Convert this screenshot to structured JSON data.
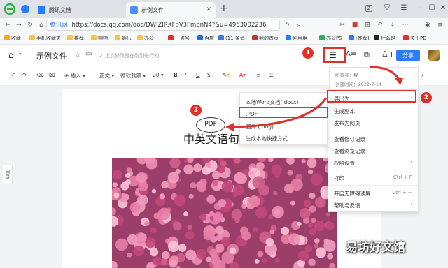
{
  "browser": {
    "tabs": [
      {
        "label": "腾讯文档"
      },
      {
        "label": "示例文件"
      }
    ],
    "new_tab": "+",
    "window_badge": "2",
    "url": "https://docs.qq.com/doc/DWlZlRXFpV3FmbnN4?&u=4963002236",
    "url_shown": "https://docs.qq.com/doc/DWIZIRXFpV3FmbnN4?&u=4963002236",
    "site_label": "腾讯网"
  },
  "bookmarks": [
    {
      "label": "收藏"
    },
    {
      "label": "手机收藏夹"
    },
    {
      "label": "推荐"
    },
    {
      "label": "购物"
    },
    {
      "label": "娱乐"
    },
    {
      "label": "办公"
    },
    {
      "label": "一点号"
    },
    {
      "label": "百度"
    },
    {
      "label": "(11 条消"
    },
    {
      "label": "我的首页"
    },
    {
      "label": "剧用用"
    },
    {
      "label": "办公PS"
    },
    {
      "label": "[推荐]"
    },
    {
      "label": "什么是"
    },
    {
      "label": "关于PD"
    }
  ],
  "doc": {
    "title": "示例文件",
    "save_status": "上次修改是在刚刚进行的",
    "share_label": "分享",
    "toolbar": {
      "insert": "插入",
      "style": "正文",
      "font": "微软雅黑",
      "size": "20"
    },
    "heading": "中英文语句",
    "side_tab": "目录"
  },
  "owner_info": {
    "owner": "所有者：我",
    "created": "创建时间：2022-7-14"
  },
  "main_menu": [
    {
      "label": "导出为",
      "shortcut": "›"
    },
    {
      "label": "生成副本",
      "shortcut": ""
    },
    {
      "label": "发布为网页",
      "shortcut": ""
    },
    {
      "label": "查看修订记录",
      "shortcut": ""
    },
    {
      "label": "查看浏览记录",
      "shortcut": ""
    },
    {
      "label": "权限设置",
      "shortcut": "›"
    },
    {
      "label": "打印",
      "shortcut": "Ctrl + P"
    },
    {
      "label": "开启无障碍读屏",
      "shortcut": "Ctrl + ←"
    },
    {
      "label": "帮助与反馈",
      "shortcut": "›"
    }
  ],
  "export_menu": [
    {
      "label": "本地Word文档(.docx)"
    },
    {
      "label": ".PDF"
    },
    {
      "label": "图片 (.png)"
    },
    {
      "label": "生成本地快捷方式"
    }
  ],
  "annotations": {
    "step1": "1",
    "step2": "2",
    "step3": "3",
    "callout": "PDF"
  },
  "watermark": "易坊好文馆",
  "colors": {
    "accent": "#2b7cff",
    "annotation_red": "#e0302a"
  }
}
